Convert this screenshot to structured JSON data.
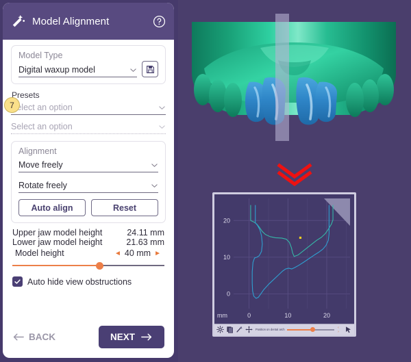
{
  "panel": {
    "title": "Model Alignment",
    "wand_icon": "magic-wand-icon",
    "help_icon": "help-circle-icon",
    "badge_number": "7",
    "model_type": {
      "label": "Model Type",
      "value": "Digital waxup model",
      "save_icon": "floppy-disk-save-icon",
      "caret_icon": "chevron-down-icon"
    },
    "presets": {
      "label": "Presets",
      "option1_placeholder": "Select an option",
      "option2_placeholder": "Select an option"
    },
    "alignment": {
      "label": "Alignment",
      "move_value": "Move freely",
      "rotate_value": "Rotate freely",
      "auto_align_label": "Auto align",
      "reset_label": "Reset"
    },
    "measurements": [
      {
        "label": "Upper jaw model height",
        "value": "24.11 mm"
      },
      {
        "label": "Lower jaw model height",
        "value": "21.63 mm"
      }
    ],
    "model_height": {
      "label": "Model height",
      "value": "40 mm",
      "left_arrow": "◄",
      "right_arrow": "►",
      "slider_percent": 57
    },
    "auto_hide": {
      "label": "Auto hide view obstructions",
      "checked": true,
      "check_icon": "checkmark-icon"
    },
    "footer": {
      "back_label": "BACK",
      "back_icon": "arrow-left-icon",
      "next_label": "NEXT",
      "next_icon": "arrow-right-icon"
    }
  },
  "viewer": {
    "name": "dental-model-3d-view",
    "chevron_icon": "double-chevron-down-icon"
  },
  "chart_toolbar": {
    "gear_icon": "gear-icon",
    "copy_icon": "copy-icon",
    "ruler_icon": "measure-icon",
    "move_icon": "move-crosshair-icon",
    "label": "Position on dental arch",
    "steppers": "‹ ›",
    "cursor_icon": "pointer-icon"
  },
  "chart_data": {
    "type": "line",
    "title": "",
    "xlabel": "mm",
    "ylabel": "mm",
    "unit_label": "mm",
    "xticks": [
      0,
      10,
      20
    ],
    "yticks": [
      0,
      10,
      20
    ],
    "xlim": [
      -4,
      26
    ],
    "ylim": [
      -4,
      26
    ],
    "grid": true,
    "legend": false,
    "series": [
      {
        "name": "jaw-cross-section-outline",
        "color": "#35b8a8",
        "points": [
          [
            0.4,
            24.2
          ],
          [
            0.4,
            20.0
          ],
          [
            1.2,
            19.6
          ],
          [
            2.0,
            19.0
          ],
          [
            2.6,
            18.2
          ],
          [
            3.4,
            17.0
          ],
          [
            4.2,
            16.2
          ],
          [
            5.4,
            15.6
          ],
          [
            6.8,
            15.3
          ],
          [
            8.4,
            15.2
          ],
          [
            9.6,
            14.9
          ],
          [
            10.4,
            14.0
          ],
          [
            10.9,
            12.6
          ],
          [
            11.2,
            11.2
          ],
          [
            11.6,
            10.2
          ],
          [
            12.6,
            10.6
          ],
          [
            13.8,
            11.6
          ],
          [
            15.0,
            12.6
          ],
          [
            16.2,
            13.6
          ],
          [
            17.4,
            14.6
          ],
          [
            18.6,
            15.4
          ],
          [
            19.6,
            16.4
          ],
          [
            20.4,
            17.6
          ],
          [
            21.2,
            19.0
          ],
          [
            21.6,
            20.2
          ],
          [
            21.6,
            24.2
          ]
        ]
      },
      {
        "name": "model-base-outline",
        "color": "#2f9fd0",
        "points": [
          [
            1.6,
            24.2
          ],
          [
            1.6,
            19.4
          ],
          [
            2.2,
            18.6
          ],
          [
            2.8,
            17.4
          ],
          [
            3.2,
            15.8
          ],
          [
            3.4,
            13.6
          ],
          [
            3.2,
            11.6
          ],
          [
            2.6,
            10.4
          ],
          [
            2.0,
            10.0
          ],
          [
            1.4,
            9.8
          ],
          [
            1.0,
            8.6
          ],
          [
            0.8,
            6.0
          ],
          [
            0.8,
            3.0
          ],
          [
            0.9,
            0.8
          ],
          [
            1.2,
            -0.6
          ],
          [
            1.8,
            -1.2
          ],
          [
            2.4,
            -0.9
          ],
          [
            3.0,
            0.0
          ],
          [
            3.8,
            1.2
          ],
          [
            5.0,
            2.6
          ],
          [
            6.4,
            4.0
          ],
          [
            7.6,
            5.2
          ],
          [
            8.6,
            6.2
          ],
          [
            9.4,
            6.8
          ],
          [
            10.2,
            7.0
          ],
          [
            11.0,
            6.8
          ],
          [
            11.8,
            7.2
          ],
          [
            12.8,
            7.8
          ],
          [
            14.0,
            8.6
          ],
          [
            15.4,
            9.6
          ],
          [
            16.8,
            10.6
          ],
          [
            18.0,
            11.4
          ],
          [
            19.0,
            12.2
          ],
          [
            19.8,
            13.2
          ],
          [
            20.4,
            14.6
          ],
          [
            20.6,
            16.4
          ],
          [
            20.6,
            18.6
          ],
          [
            20.6,
            24.2
          ]
        ]
      }
    ],
    "markers": [
      {
        "name": "arch-position-marker",
        "x": 13.2,
        "y": 15.3,
        "color": "#f0d020"
      }
    ]
  },
  "colors": {
    "brand_purple": "#4a3f74",
    "header_purple": "#584a80",
    "viewport_bg": "#4a3e6c",
    "accent_orange": "#ec7f49",
    "badge_yellow": "#fae08a",
    "chevron_red": "#ee1111",
    "gum_green": "#1d9e79",
    "tooth_blue": "#2f86c8"
  }
}
